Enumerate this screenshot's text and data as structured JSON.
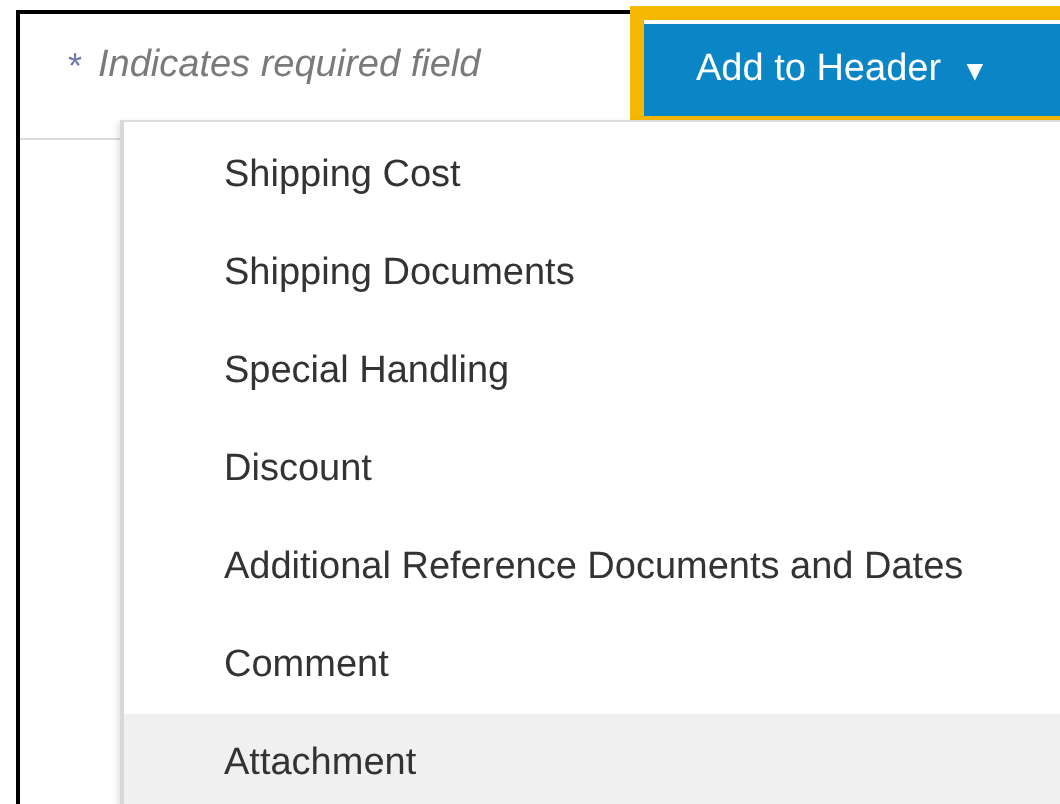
{
  "required_note": {
    "mark": "*",
    "text": "Indicates required field"
  },
  "add_button": {
    "label": "Add to Header",
    "caret": "▼",
    "expanded": true
  },
  "menu": {
    "items": [
      {
        "label": "Shipping Cost",
        "selected": false
      },
      {
        "label": "Shipping Documents",
        "selected": false
      },
      {
        "label": "Special Handling",
        "selected": false
      },
      {
        "label": "Discount",
        "selected": false
      },
      {
        "label": "Additional Reference Documents and Dates",
        "selected": false
      },
      {
        "label": "Comment",
        "selected": false
      },
      {
        "label": "Attachment",
        "selected": true
      }
    ]
  }
}
